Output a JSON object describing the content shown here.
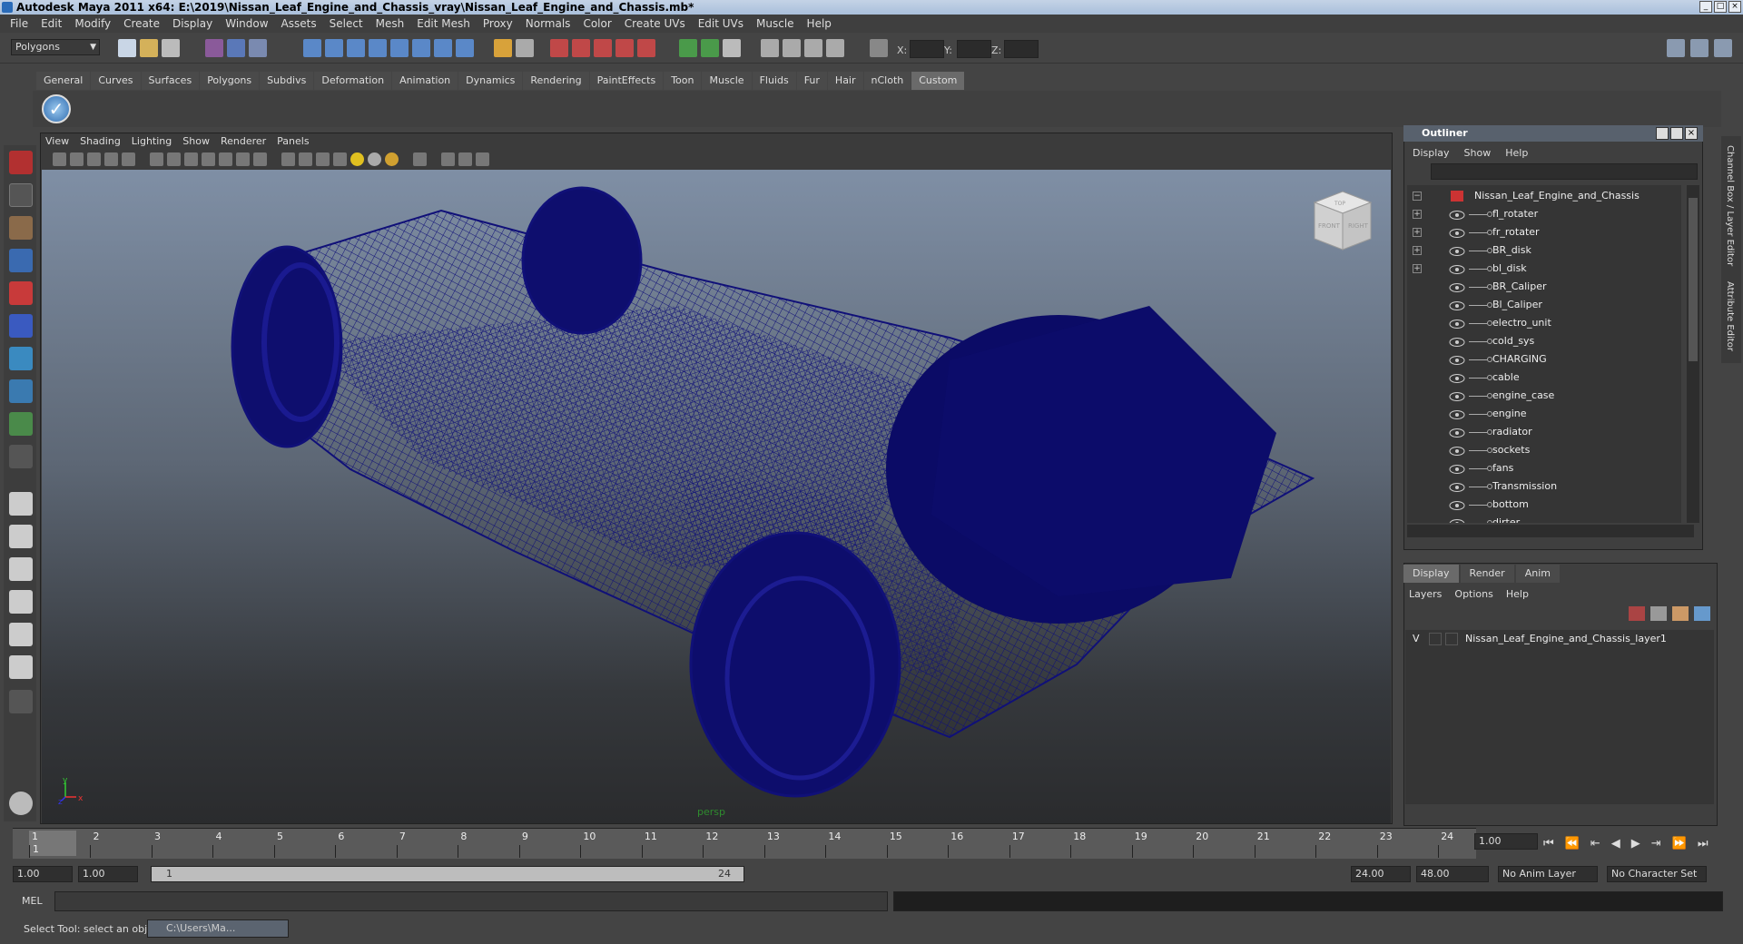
{
  "window": {
    "title": "Autodesk Maya 2011 x64: E:\\2019\\Nissan_Leaf_Engine_and_Chassis_vray\\Nissan_Leaf_Engine_and_Chassis.mb*",
    "controls": [
      "_",
      "□",
      "×"
    ]
  },
  "menubar": [
    "File",
    "Edit",
    "Modify",
    "Create",
    "Display",
    "Window",
    "Assets",
    "Select",
    "Mesh",
    "Edit Mesh",
    "Proxy",
    "Normals",
    "Color",
    "Create UVs",
    "Edit UVs",
    "Muscle",
    "Help"
  ],
  "toolbar": {
    "mode": "Polygons",
    "coord_labels": {
      "x": "X:",
      "y": "Y:",
      "z": "Z:"
    }
  },
  "shelf": {
    "tabs": [
      "General",
      "Curves",
      "Surfaces",
      "Polygons",
      "Subdivs",
      "Deformation",
      "Animation",
      "Dynamics",
      "Rendering",
      "PaintEffects",
      "Toon",
      "Muscle",
      "Fluids",
      "Fur",
      "Hair",
      "nCloth",
      "Custom"
    ],
    "active_tab": "Custom"
  },
  "viewport": {
    "menu": [
      "View",
      "Shading",
      "Lighting",
      "Show",
      "Renderer",
      "Panels"
    ],
    "camera_label": "persp",
    "viewcube": {
      "front": "FRONT",
      "right": "RIGHT",
      "top": "TOP"
    },
    "axis": {
      "x": "x",
      "y": "y",
      "z": "z"
    },
    "wire_color": "#101078"
  },
  "outliner": {
    "title": "Outliner",
    "menu": [
      "Display",
      "Show",
      "Help"
    ],
    "root": "Nissan_Leaf_Engine_and_Chassis",
    "items": [
      {
        "label": "fl_rotater",
        "expandable": "+"
      },
      {
        "label": "fr_rotater",
        "expandable": "+"
      },
      {
        "label": "BR_disk",
        "expandable": "+"
      },
      {
        "label": "bl_disk",
        "expandable": "+"
      },
      {
        "label": "BR_Caliper",
        "expandable": ""
      },
      {
        "label": "Bl_Caliper",
        "expandable": ""
      },
      {
        "label": "electro_unit",
        "expandable": ""
      },
      {
        "label": "cold_sys",
        "expandable": ""
      },
      {
        "label": "CHARGING",
        "expandable": ""
      },
      {
        "label": "cable",
        "expandable": ""
      },
      {
        "label": "engine_case",
        "expandable": ""
      },
      {
        "label": "engine",
        "expandable": ""
      },
      {
        "label": "radiator",
        "expandable": ""
      },
      {
        "label": "sockets",
        "expandable": ""
      },
      {
        "label": "fans",
        "expandable": ""
      },
      {
        "label": "Transmission",
        "expandable": ""
      },
      {
        "label": "bottom",
        "expandable": ""
      },
      {
        "label": "dirter",
        "expandable": ""
      }
    ]
  },
  "layer_editor": {
    "tabs": [
      "Display",
      "Render",
      "Anim"
    ],
    "active_tab": "Display",
    "menu": [
      "Layers",
      "Options",
      "Help"
    ],
    "layers": [
      {
        "visible": "V",
        "name": "Nissan_Leaf_Engine_and_Chassis_layer1"
      }
    ]
  },
  "side_tabs": [
    "Channel Box / Layer Editor",
    "Attribute Editor"
  ],
  "timeline": {
    "ticks": [
      "1",
      "2",
      "3",
      "4",
      "5",
      "6",
      "7",
      "8",
      "9",
      "10",
      "11",
      "12",
      "13",
      "14",
      "15",
      "16",
      "17",
      "18",
      "19",
      "20",
      "21",
      "22",
      "23",
      "24"
    ],
    "current_frame_marker": "1",
    "current_time": "1.00"
  },
  "range": {
    "start": "1.00",
    "playback_start": "1.00",
    "bar_start": "1",
    "bar_end": "24",
    "playback_end": "24.00",
    "end": "48.00",
    "anim_layer": "No Anim Layer",
    "character_set": "No Character Set"
  },
  "command_line": {
    "label": "MEL"
  },
  "help_line": {
    "text": "Select Tool: select an object",
    "task_button": "C:\\Users\\Ma..."
  }
}
